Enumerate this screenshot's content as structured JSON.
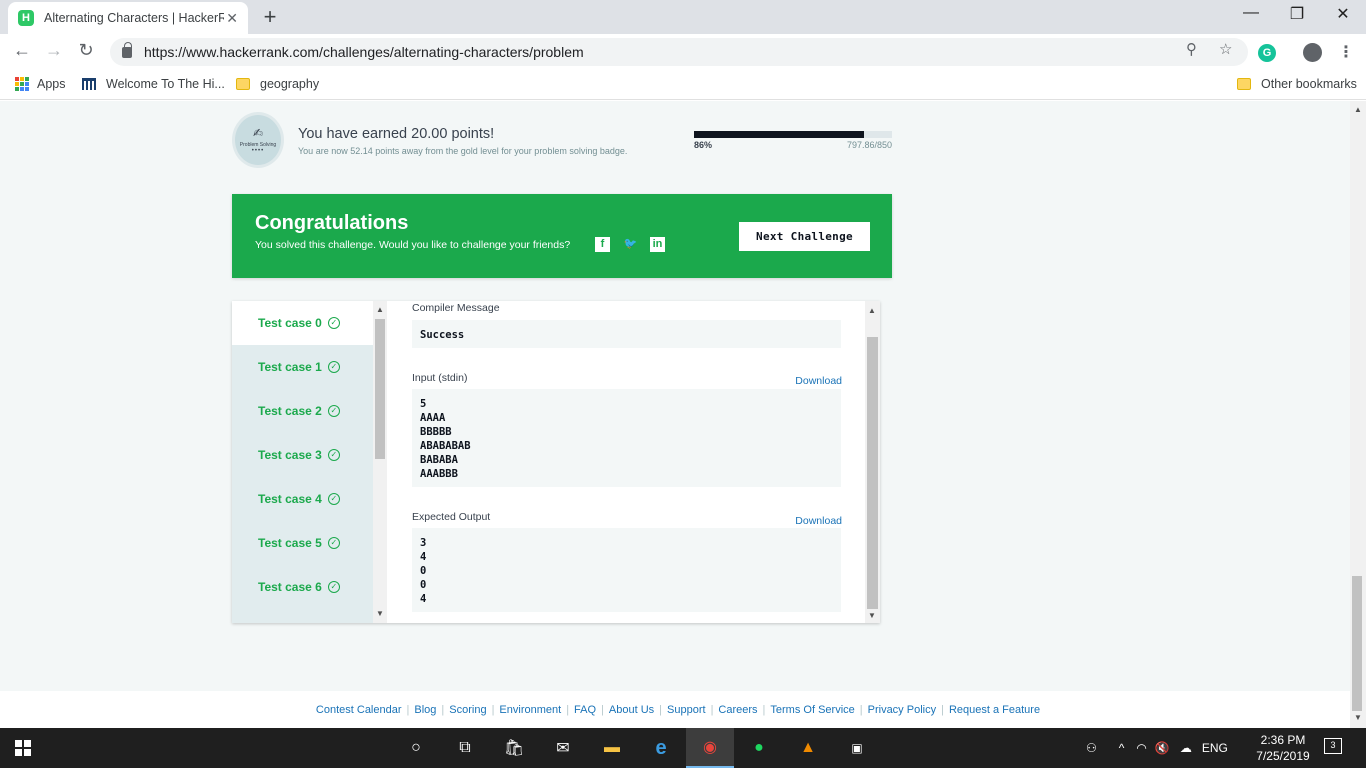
{
  "browser": {
    "tab_title": "Alternating Characters | HackerRank",
    "tab_favicon": "H",
    "new_tab": "+",
    "close_tab": "✕",
    "minimize": "—",
    "restore": "❐",
    "close": "✕",
    "url": "https://www.hackerrank.com/challenges/alternating-characters/problem",
    "extension": "G",
    "bookmarks": [
      {
        "label": "Apps"
      },
      {
        "label": "Welcome To The Hi..."
      },
      {
        "label": "geography"
      }
    ],
    "other_bookmarks": "Other bookmarks"
  },
  "earned": {
    "badge_label": "Problem Solving",
    "badge_stars": "••••",
    "points_text": "You have earned 20.00 points!",
    "away_text": "You are now 52.14 points away from the gold level for your problem solving badge.",
    "progress_fraction": 0.86,
    "progress_pct": "86%",
    "progress_points": "797.86/850"
  },
  "congrats": {
    "title": "Congratulations",
    "subtitle": "You solved this challenge. Would you like to challenge your friends?",
    "next_button": "Next Challenge",
    "color": "#1ba94c"
  },
  "test_cases": [
    {
      "label": "Test case 0"
    },
    {
      "label": "Test case 1"
    },
    {
      "label": "Test case 2"
    },
    {
      "label": "Test case 3"
    },
    {
      "label": "Test case 4"
    },
    {
      "label": "Test case 5"
    },
    {
      "label": "Test case 6"
    }
  ],
  "output": {
    "compiler_label": "Compiler Message",
    "compiler_value": "Success",
    "input_label": "Input (stdin)",
    "input_download": "Download",
    "input_lines": [
      "5",
      "AAAA",
      "BBBBB",
      "ABABABAB",
      "BABABA",
      "AAABBB"
    ],
    "expected_label": "Expected Output",
    "expected_download": "Download",
    "expected_lines": [
      "3",
      "4",
      "0",
      "0",
      "4"
    ]
  },
  "footer": {
    "links": [
      "Contest Calendar",
      "Blog",
      "Scoring",
      "Environment",
      "FAQ",
      "About Us",
      "Support",
      "Careers",
      "Terms Of Service",
      "Privacy Policy",
      "Request a Feature"
    ]
  },
  "taskbar": {
    "lang": "ENG",
    "time": "2:36 PM",
    "date": "7/25/2019",
    "notifications": "3"
  }
}
